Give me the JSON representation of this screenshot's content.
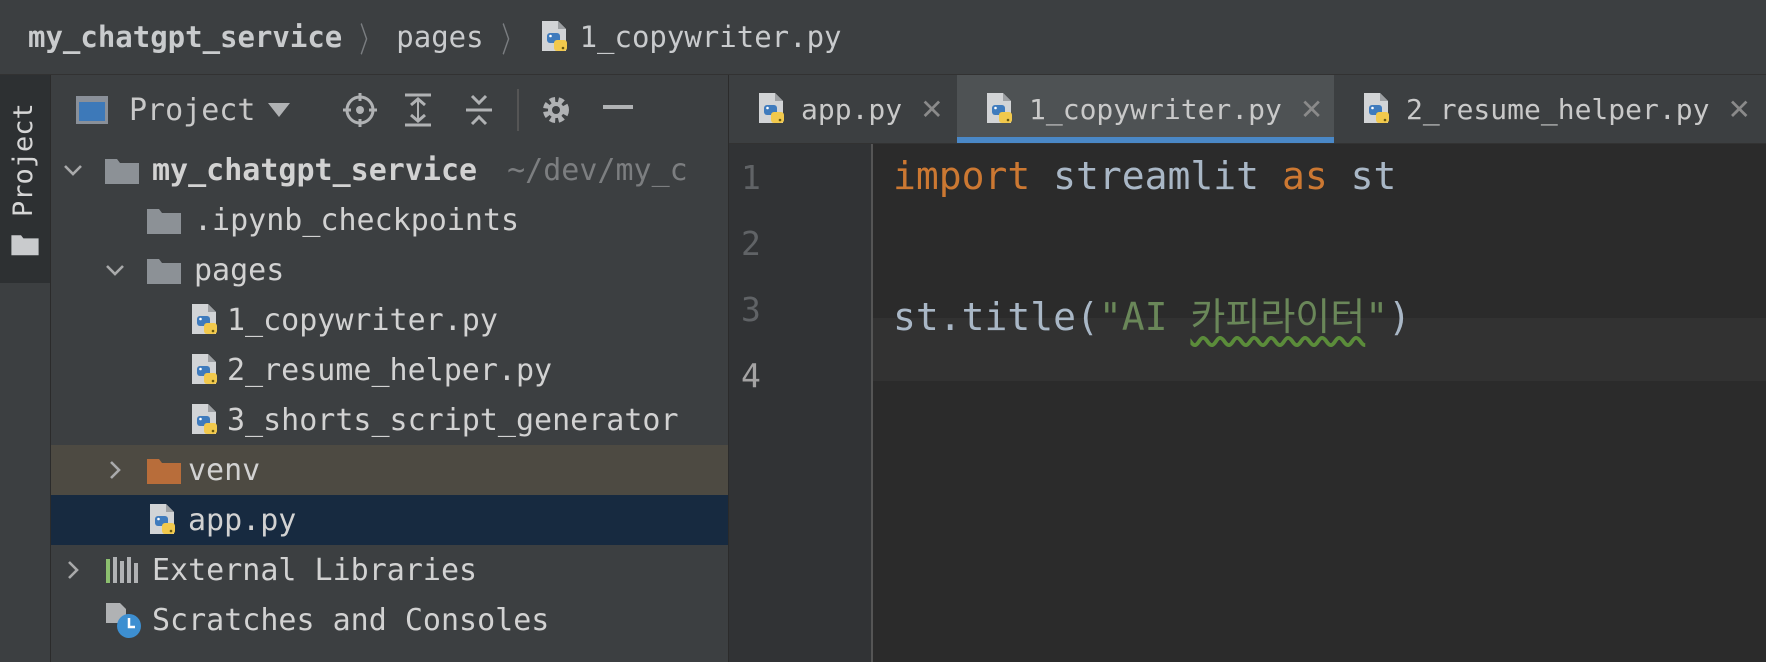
{
  "breadcrumb": {
    "project": "my_chatgpt_service",
    "folder": "pages",
    "file": "1_copywriter.py"
  },
  "tool_stripe": {
    "project_tab": "Project"
  },
  "project_panel": {
    "title": "Project",
    "tree": {
      "root": {
        "name": "my_chatgpt_service",
        "path": "~/dev/my_c"
      },
      "ipynb": ".ipynb_checkpoints",
      "pages": "pages",
      "pages_files": [
        "1_copywriter.py",
        "2_resume_helper.py",
        "3_shorts_script_generator"
      ],
      "venv": "venv",
      "app": "app.py",
      "external": "External Libraries",
      "scratches": "Scratches and Consoles"
    }
  },
  "editor": {
    "tabs": [
      {
        "label": "app.py",
        "active": false
      },
      {
        "label": "1_copywriter.py",
        "active": true
      },
      {
        "label": "2_resume_helper.py",
        "active": false
      }
    ],
    "line_numbers": [
      "1",
      "2",
      "3",
      "4"
    ],
    "code": {
      "l1_kw1": "import",
      "l1_mid": " streamlit ",
      "l1_kw2": "as",
      "l1_end": " st",
      "l3_pre": "st.title(",
      "l3_q1": "\"AI ",
      "l3_kr": "카피라이터",
      "l3_q2": "\"",
      "l3_post": ")"
    }
  },
  "colors": {
    "accent": "#4a88c7",
    "keyword": "#cc7832",
    "string": "#6a8759",
    "folder": "#8c9196",
    "venv_folder": "#b86d3a"
  }
}
